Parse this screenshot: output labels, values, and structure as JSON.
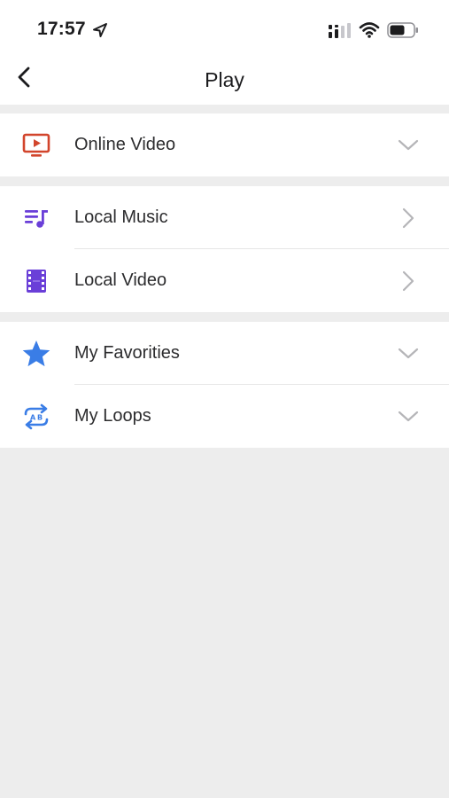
{
  "status_bar": {
    "time": "17:57"
  },
  "nav": {
    "title": "Play"
  },
  "sections": [
    {
      "rows": [
        {
          "label": "Online Video",
          "icon": "tv-play-icon",
          "icon_color": "#d2452c",
          "accessory": "chevron-down"
        }
      ]
    },
    {
      "rows": [
        {
          "label": "Local Music",
          "icon": "music-list-icon",
          "icon_color": "#6a3fd8",
          "accessory": "chevron-right"
        },
        {
          "label": "Local Video",
          "icon": "film-icon",
          "icon_color": "#6a3fd8",
          "accessory": "chevron-right"
        }
      ]
    },
    {
      "rows": [
        {
          "label": "My Favorities",
          "icon": "star-icon",
          "icon_color": "#3a7de6",
          "accessory": "chevron-down"
        },
        {
          "label": "My Loops",
          "icon": "ab-loop-icon",
          "icon_color": "#3a7de6",
          "accessory": "chevron-down"
        }
      ]
    }
  ],
  "colors": {
    "background": "#ededed",
    "row_background": "#ffffff",
    "chevron": "#b5b5b8"
  }
}
